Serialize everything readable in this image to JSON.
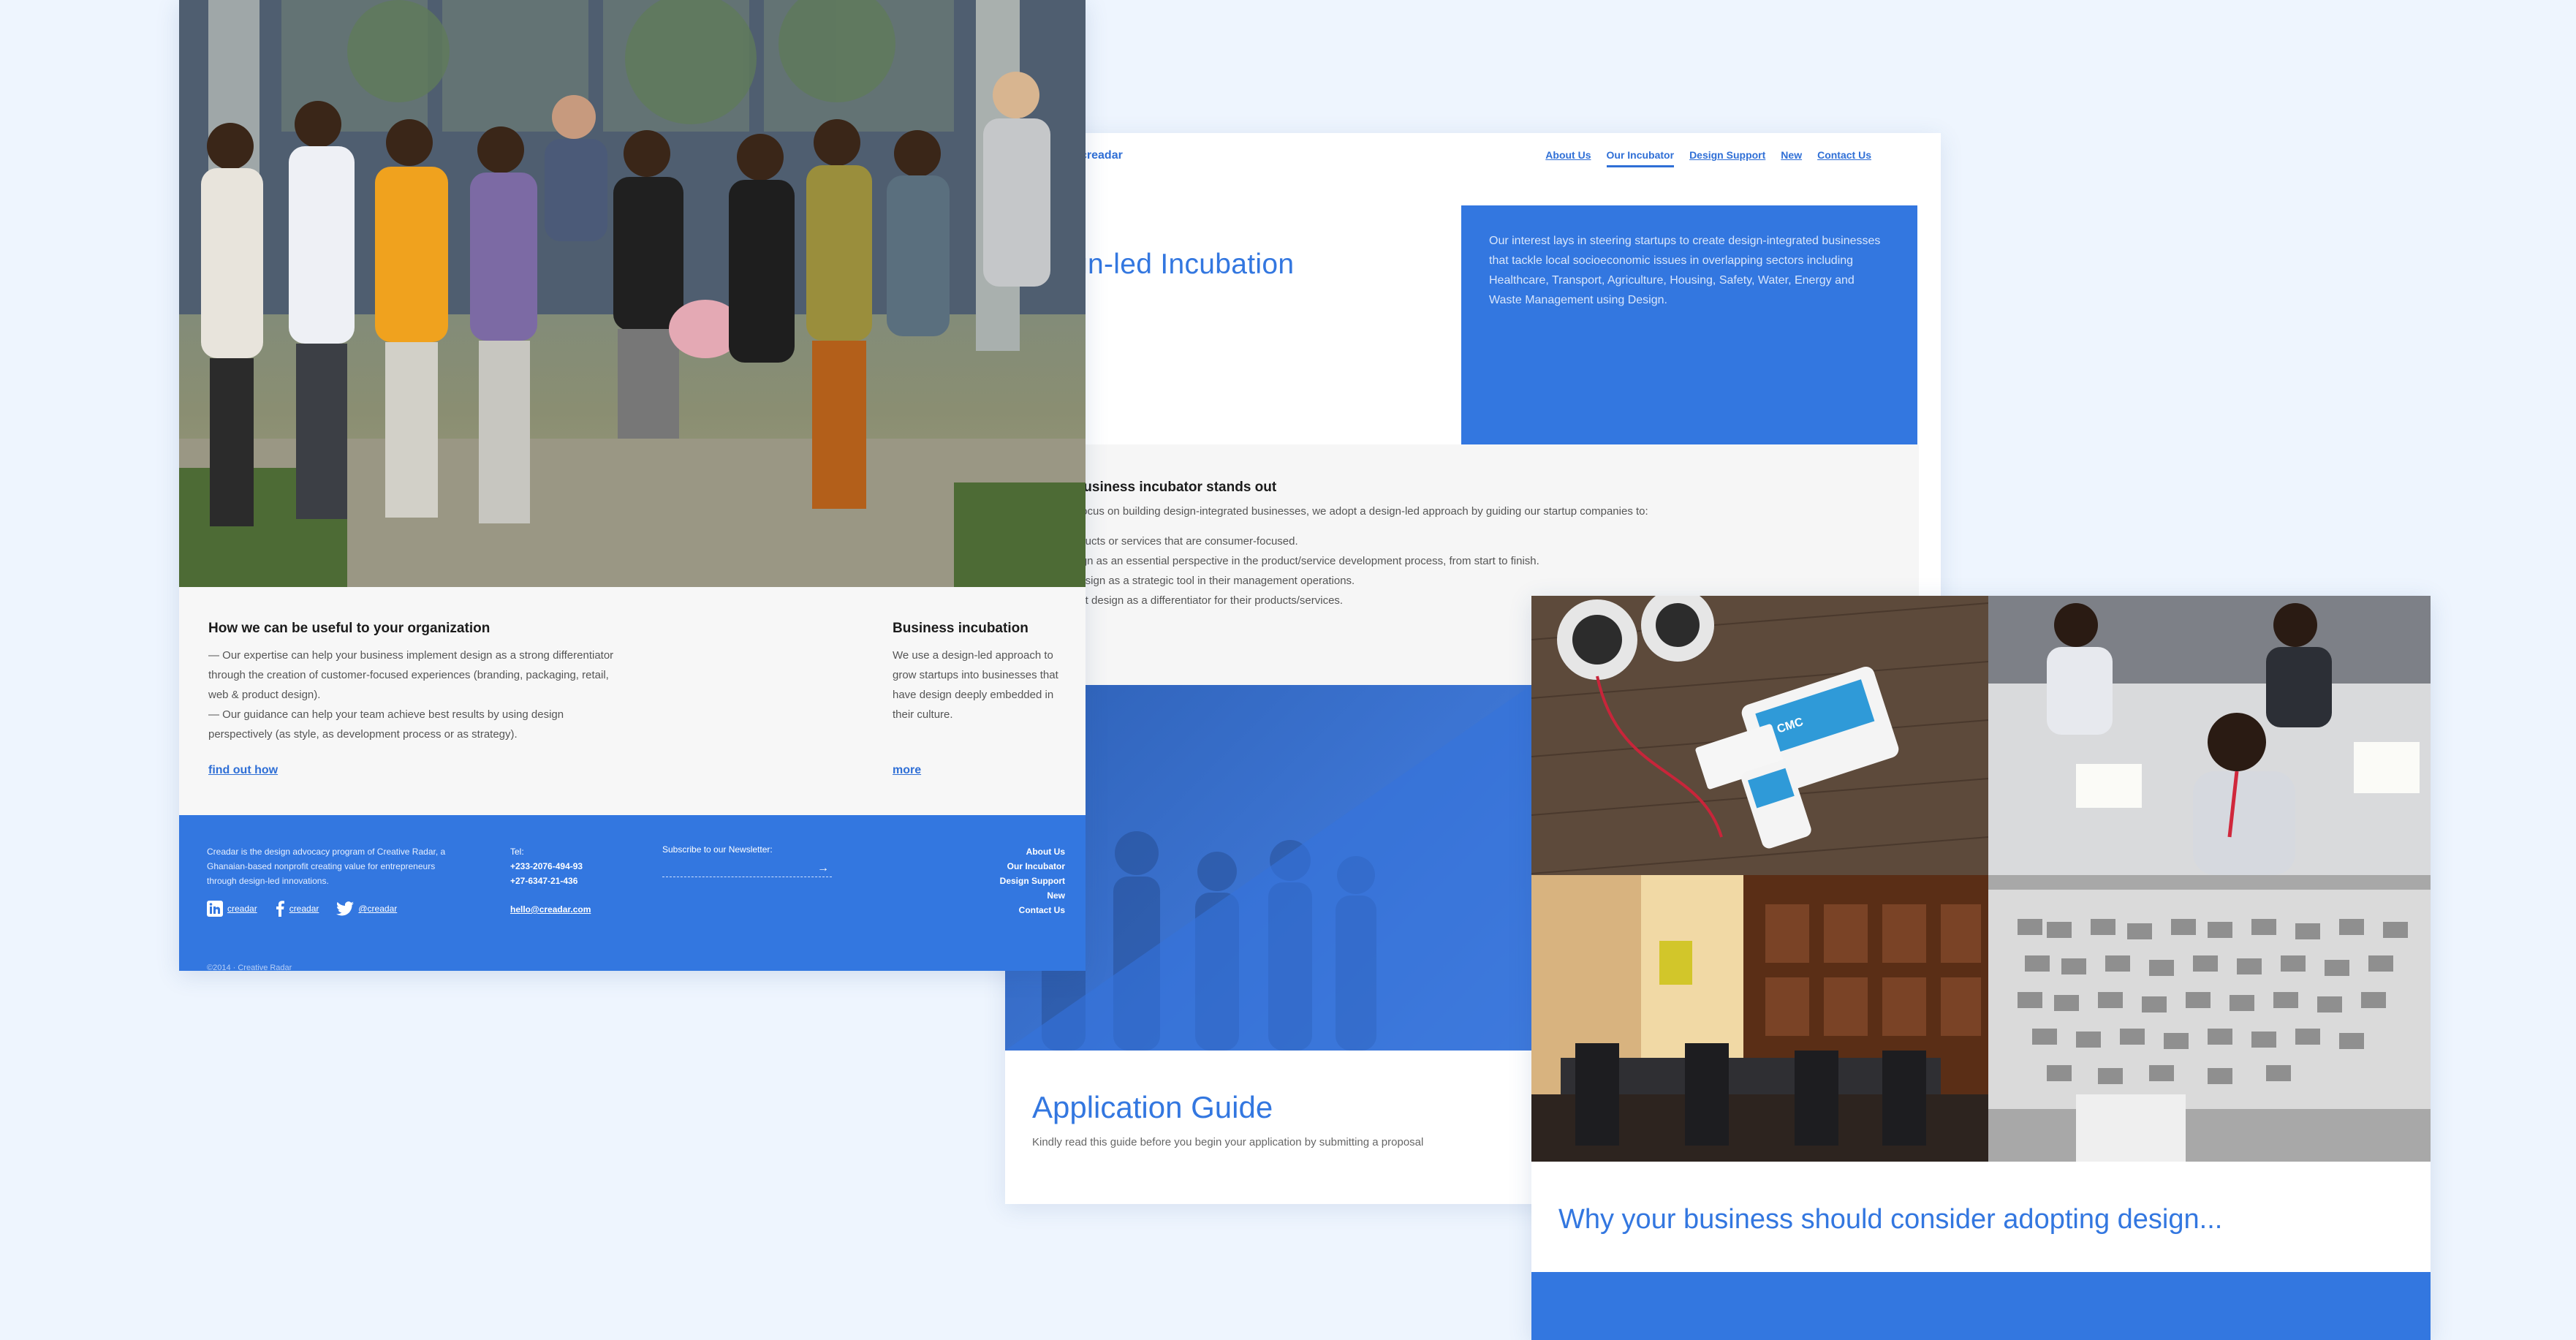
{
  "incubation": {
    "logo": "creadar",
    "nav": [
      "About Us",
      "Our Incubator",
      "Design Support",
      "New",
      "Contact Us"
    ],
    "hero_title": "gn-led  Incubation",
    "hero_text": "Our interest lays in steering startups to create design-integrated businesses that tackle local socioeconomic issues in overlapping sectors including Healthcare, Transport, Agriculture, Housing, Safety, Water, Energy and Waste Management using Design.",
    "stands_title": "r business incubator stands out",
    "stands_intro": "focus on building design-integrated businesses, we adopt a design-led approach by guiding our startup companies to:",
    "stands_list": [
      "oducts or services that are consumer-focused.",
      "sign as an essential perspective in the product/service development process, from start to finish.",
      "design as a strategic tool in their management operations.",
      "ent design as a differentiator for their products/services."
    ],
    "app_title": "Application Guide",
    "app_sub": "Kindly read this guide before you begin your application by submitting a proposal"
  },
  "organization": {
    "useful_title": "How we can be useful to your organization",
    "useful_text_1": "— Our expertise can help your business implement design as a strong differentiator through the creation of customer-focused experiences (branding, packaging, retail, web & product design).",
    "useful_text_2": "— Our guidance can help your team achieve best results by using design perspectively (as style, as development process or as strategy).",
    "find_out": "find out how",
    "biz_title": "Business incubation",
    "biz_text": "We use a design-led approach to grow startups into businesses that have design deeply embedded in their culture.",
    "more": "more"
  },
  "footer": {
    "about": "Creadar is the design advocacy program of Creative Radar, a Ghanaian-based nonprofit creating value for entrepreneurs through design-led innovations.",
    "social": [
      "creadar",
      "creadar",
      "@creadar"
    ],
    "tel_label": "Tel:",
    "tel_1": "+233-2076-494-93",
    "tel_2": "+27-6347-21-436",
    "email": "hello@creadar.com",
    "newsletter": "Subscribe to our Newsletter:",
    "arrow": "→",
    "links": [
      "About Us",
      "Our Incubator",
      "Design Support",
      "New",
      "Contact Us"
    ],
    "copyright": "©2014 · Creative Radar"
  },
  "design": {
    "why_title": "Why your business should consider adopting design...",
    "card_brand": "CMC"
  },
  "colors": {
    "accent": "#3377e0",
    "page_bg": "#eef5fe"
  }
}
